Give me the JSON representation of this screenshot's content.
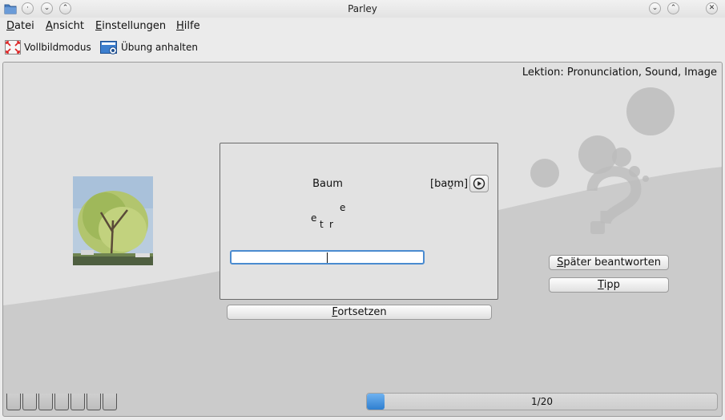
{
  "window": {
    "title": "Parley"
  },
  "menu": [
    {
      "mnemonic": "D",
      "rest": "atei"
    },
    {
      "mnemonic": "A",
      "rest": "nsicht"
    },
    {
      "mnemonic": "E",
      "rest": "instellungen"
    },
    {
      "mnemonic": "H",
      "rest": "ilfe"
    }
  ],
  "toolbar": {
    "fullscreen_label": "Vollbildmodus",
    "pause_label": "Übung anhalten"
  },
  "lesson_label": "Lektion: Pronunciation, Sound, Image",
  "question": {
    "word": "Baum",
    "pronunciation": "[baʊ̯m]",
    "scrambled_letters": [
      "e",
      "t",
      "r",
      "e"
    ],
    "answer_value": ""
  },
  "buttons": {
    "continue": {
      "mnemonic": "F",
      "rest": "ortsetzen"
    },
    "answer_later": {
      "mnemonic": "S",
      "rest": "päter beantworten"
    },
    "hint": {
      "mnemonic": "T",
      "rest": "ipp"
    }
  },
  "progress": {
    "text": "1/20",
    "fraction": 0.05
  },
  "counter_boxes": 7,
  "icons": {
    "app": "folder-icon",
    "fullscreen": "fullscreen-icon",
    "pause": "pause-exercise-icon",
    "play": "play-icon"
  },
  "colors": {
    "accent": "#3d88d8"
  }
}
